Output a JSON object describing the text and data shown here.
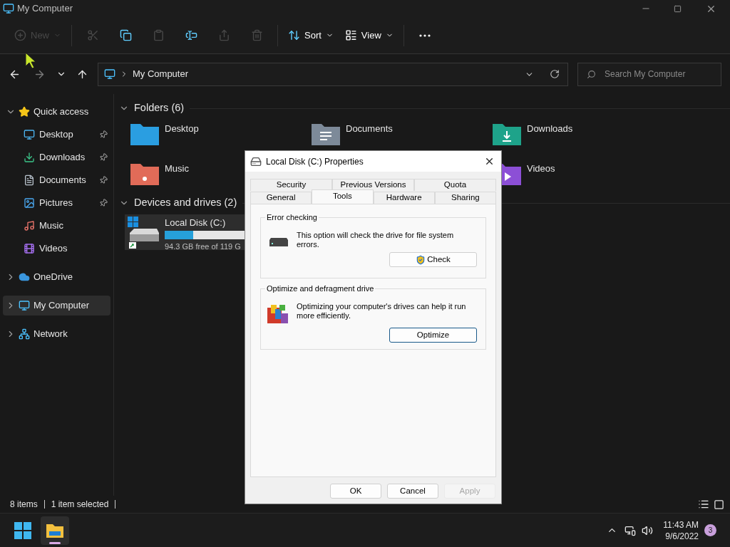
{
  "window": {
    "title": "My Computer"
  },
  "toolbar": [
    {
      "kind": "new",
      "label": "New",
      "disabled": true
    },
    {
      "kind": "cut",
      "disabled": true
    },
    {
      "kind": "copy",
      "disabled": false
    },
    {
      "kind": "paste",
      "disabled": true
    },
    {
      "kind": "rename",
      "disabled": false
    },
    {
      "kind": "share",
      "disabled": true
    },
    {
      "kind": "delete",
      "disabled": true
    },
    {
      "kind": "sort",
      "label": "Sort",
      "disabled": false
    },
    {
      "kind": "view",
      "label": "View",
      "disabled": false
    },
    {
      "kind": "more",
      "disabled": false
    }
  ],
  "navigation": {
    "back_disabled": false,
    "forward_disabled": true
  },
  "address": {
    "path": "My Computer"
  },
  "search": {
    "placeholder": "Search My Computer"
  },
  "sidebar": {
    "items": [
      {
        "kind": "star",
        "label": "Quick access",
        "expanded": true,
        "selected": false,
        "children": [
          {
            "kind": "desktop",
            "label": "Desktop",
            "pinned": true,
            "selected": false
          },
          {
            "kind": "downloads",
            "label": "Downloads",
            "pinned": true,
            "selected": false
          },
          {
            "kind": "documents",
            "label": "Documents",
            "pinned": true,
            "selected": false
          },
          {
            "kind": "pictures",
            "label": "Pictures",
            "pinned": true,
            "selected": false
          },
          {
            "kind": "music",
            "label": "Music",
            "pinned": false,
            "selected": false
          },
          {
            "kind": "videos",
            "label": "Videos",
            "pinned": false,
            "selected": false
          }
        ]
      },
      {
        "kind": "cloud",
        "label": "OneDrive",
        "expanded": false,
        "selected": false
      },
      {
        "kind": "computer",
        "label": "My Computer",
        "expanded": false,
        "selected": true
      },
      {
        "kind": "network",
        "label": "Network",
        "expanded": false,
        "selected": false
      }
    ]
  },
  "folders": {
    "title": "Folders (6)",
    "expanded": true,
    "items": [
      {
        "kind": "desktop",
        "name": "Desktop"
      },
      {
        "kind": "documents",
        "name": "Documents"
      },
      {
        "kind": "downloads",
        "name": "Downloads"
      },
      {
        "kind": "music",
        "name": "Music"
      },
      {
        "kind": "videos",
        "name": "Videos"
      }
    ]
  },
  "drives": {
    "title": "Devices and drives (2)",
    "expanded": true,
    "items": [
      {
        "name": "Local Disk (C:)",
        "free": "94.3 GB free of 119 G",
        "level": 0.21,
        "selected": true
      }
    ]
  },
  "dialog": {
    "title": "Local Disk (C:) Properties",
    "tab_rows": [
      [
        {
          "label": "Security",
          "selected": false
        },
        {
          "label": "Previous Versions",
          "selected": false
        },
        {
          "label": "Quota",
          "selected": false
        }
      ],
      [
        {
          "label": "General",
          "selected": false
        },
        {
          "label": "Tools",
          "selected": true
        },
        {
          "label": "Hardware",
          "selected": false
        },
        {
          "label": "Sharing",
          "selected": false
        }
      ]
    ],
    "groups": [
      {
        "kind": "check",
        "title": "Error checking",
        "text": "This option will check the drive for file system errors.",
        "button": "Check",
        "focused": false
      },
      {
        "kind": "optimize",
        "title": "Optimize and defragment drive",
        "text": "Optimizing your computer's drives can help it run more efficiently.",
        "button": "Optimize",
        "focused": true
      }
    ],
    "buttons": [
      {
        "label": "OK",
        "disabled": false
      },
      {
        "label": "Cancel",
        "disabled": false
      },
      {
        "label": "Apply",
        "disabled": true
      }
    ]
  },
  "status_bar": {
    "items": [
      "8 items",
      "1 item selected"
    ]
  },
  "taskbar": {
    "apps": [
      {
        "kind": "start",
        "active": false
      },
      {
        "kind": "explorer",
        "active": true
      }
    ],
    "time": "11:43 AM",
    "date": "9/6/2022",
    "badge": "3"
  }
}
